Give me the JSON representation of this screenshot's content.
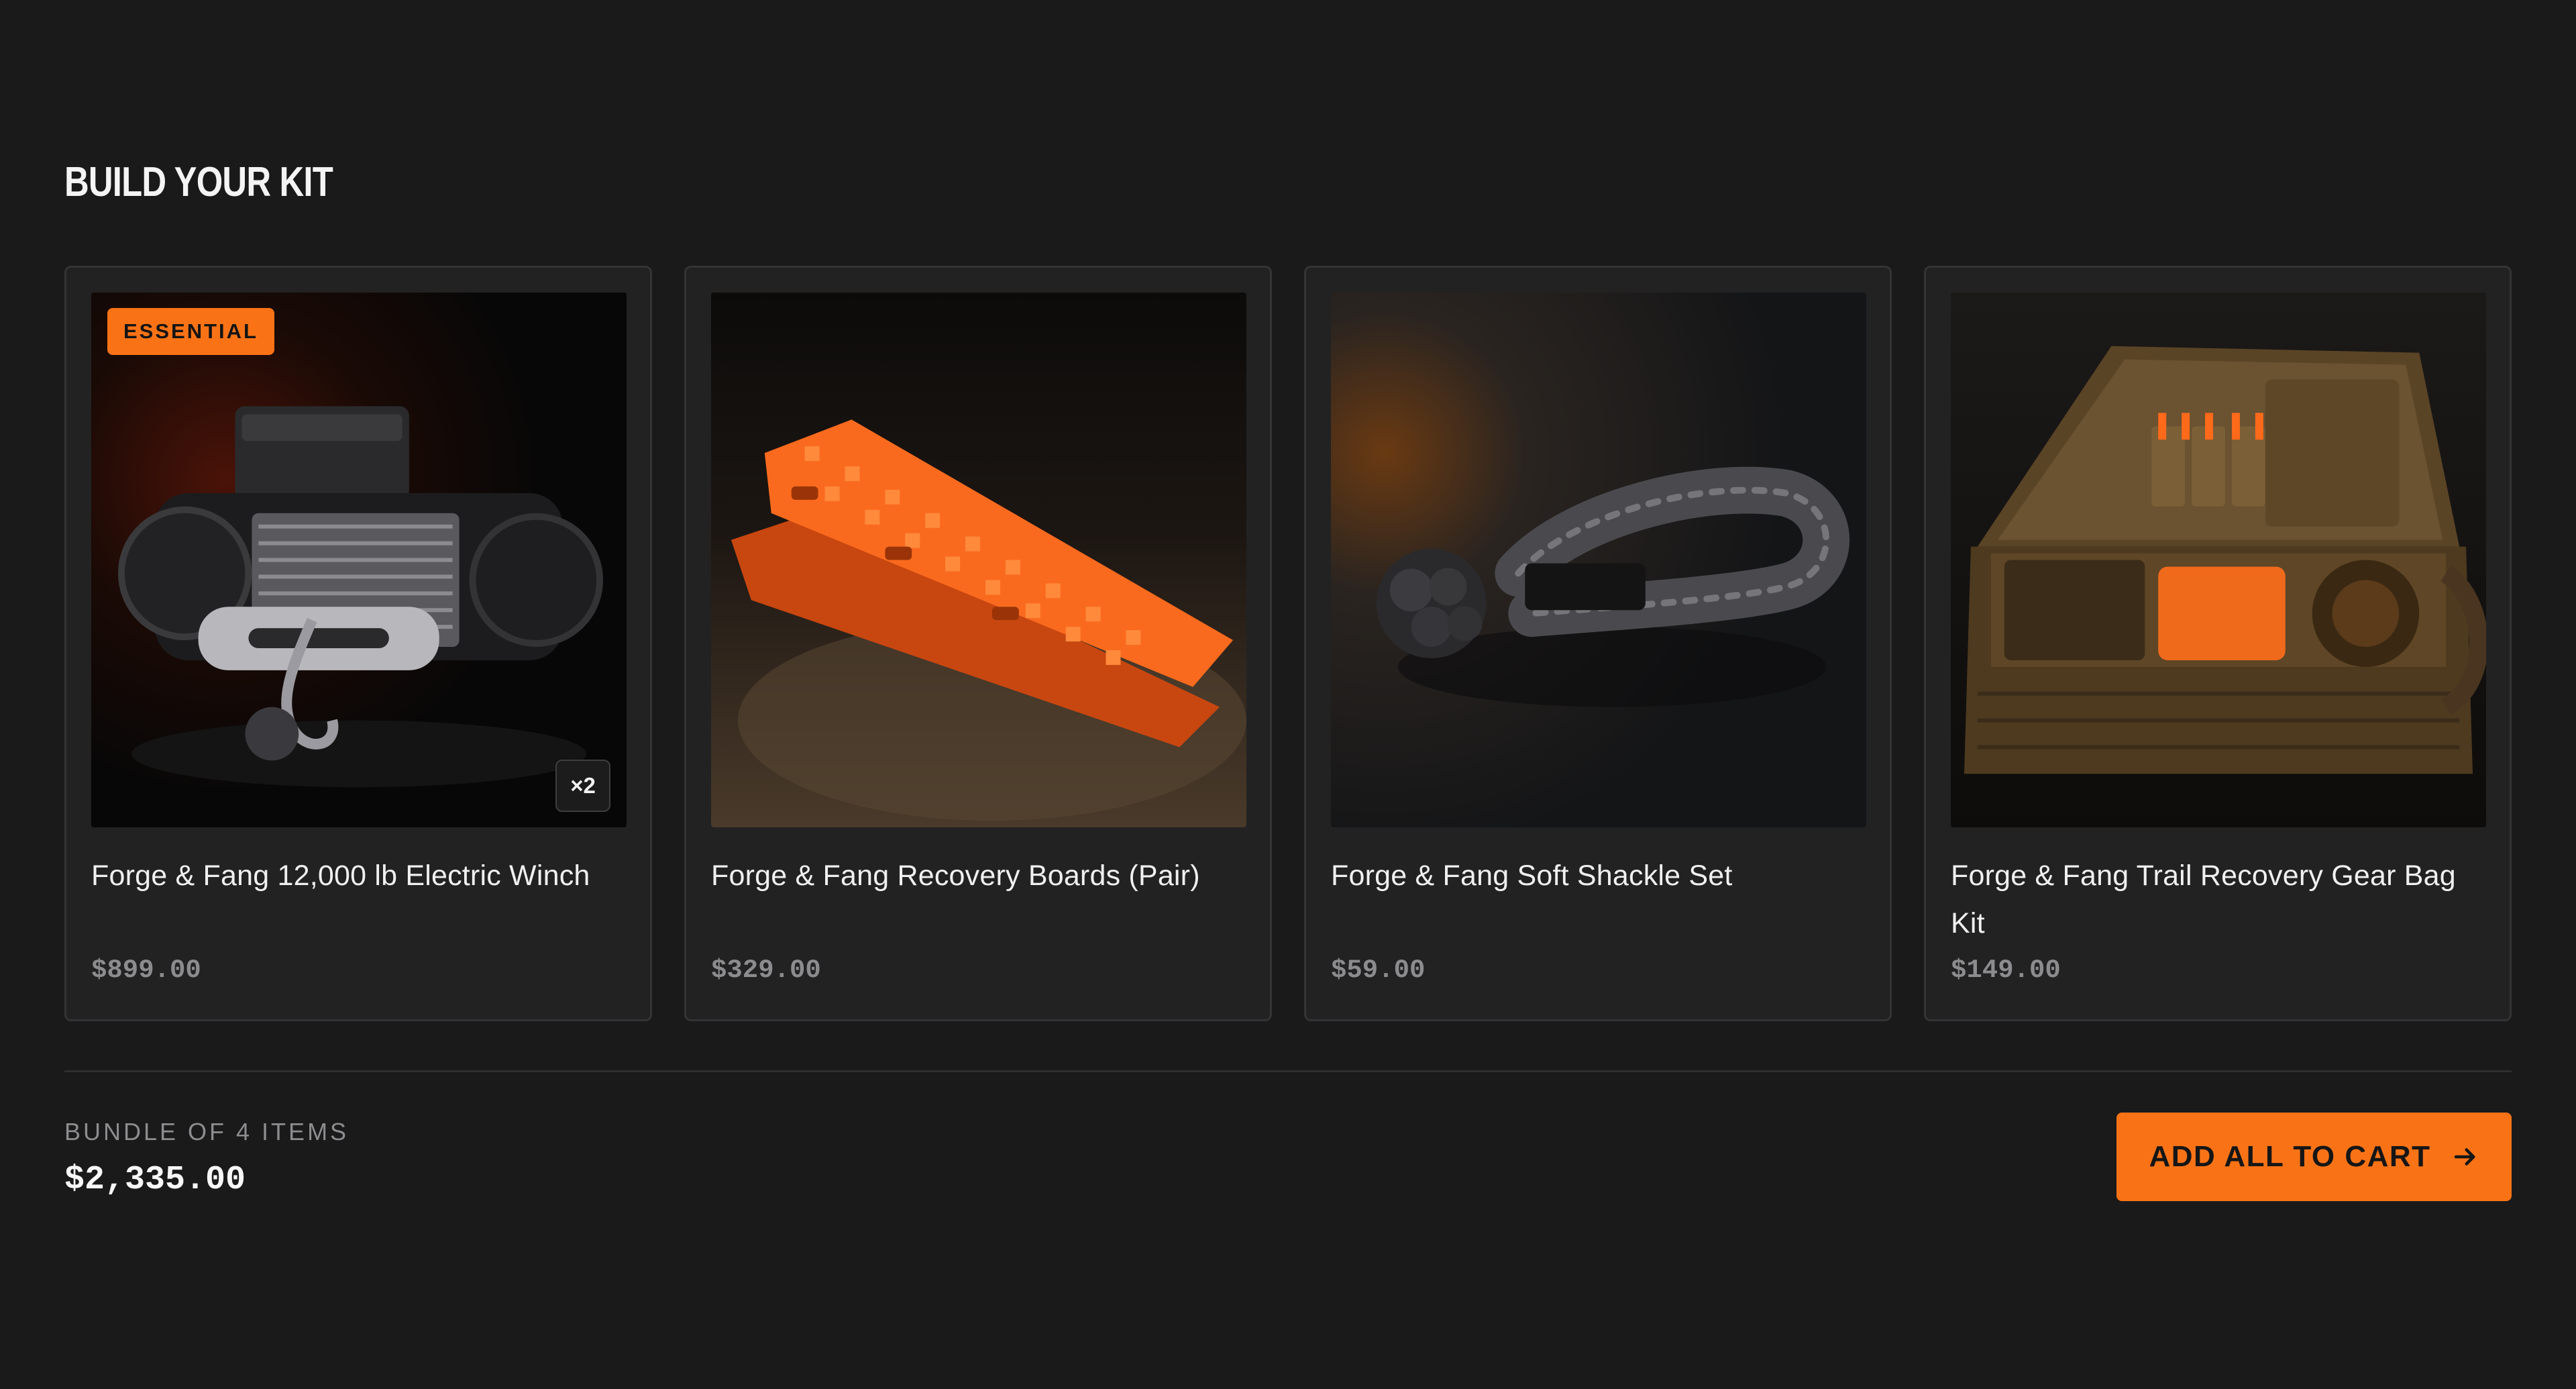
{
  "section": {
    "title": "BUILD YOUR KIT"
  },
  "products": [
    {
      "title": "Forge & Fang 12,000 lb Electric Winch",
      "price": "$899.00",
      "badge": "ESSENTIAL",
      "quantity": "×2",
      "icon": "winch-image"
    },
    {
      "title": "Forge & Fang Recovery Boards (Pair)",
      "price": "$329.00",
      "icon": "recovery-boards-image"
    },
    {
      "title": "Forge & Fang Soft Shackle Set",
      "price": "$59.00",
      "icon": "soft-shackle-image"
    },
    {
      "title": "Forge & Fang Trail Recovery Gear Bag Kit",
      "price": "$149.00",
      "icon": "gear-bag-image"
    }
  ],
  "bundle": {
    "label": "BUNDLE OF 4 ITEMS",
    "total": "$2,335.00"
  },
  "cta": {
    "label": "ADD ALL TO CART",
    "icon": "arrow-right-icon"
  },
  "colors": {
    "background": "#1a1a1b",
    "card": "#222223",
    "accent": "#f97316",
    "muted_text": "#8c8c8f"
  }
}
